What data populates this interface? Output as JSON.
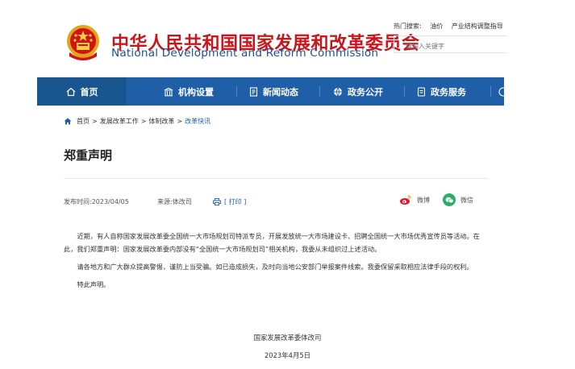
{
  "header": {
    "title_cn": "中华人民共和国国家发展和改革委员会",
    "title_en": "National Development and Reform Commission",
    "hot_label": "热门搜索:",
    "hot_items": [
      "油价",
      "产业结构调整指导"
    ],
    "search_placeholder": "请输入关键字"
  },
  "nav": {
    "items": [
      {
        "label": "首页",
        "icon": "home-icon"
      },
      {
        "label": "机构设置",
        "icon": "building-icon"
      },
      {
        "label": "新闻动态",
        "icon": "news-icon"
      },
      {
        "label": "政务公开",
        "icon": "globe-icon"
      },
      {
        "label": "政务服务",
        "icon": "service-icon"
      }
    ]
  },
  "breadcrumb": {
    "items": [
      "首页",
      "发展改革工作",
      "体制改革",
      "改革快讯"
    ],
    "separator": ">"
  },
  "article": {
    "title": "郑重声明",
    "publish_time": "发布时间:2023/04/05",
    "source": "来源:体改司",
    "print_label": "[ 打印 ]",
    "share_weibo": "微博",
    "share_weixin": "微信",
    "paragraphs": [
      "近期，有人自称国家发展改革委全国统一大市场规划司特派专员，开展发放统一大市场建设卡、招聘全国统一大市场优秀宣传员等活动。在此，我们郑重声明：国家发展改革委内部没有“全国统一大市场规划司”相关机构，我委从未组织过上述活动。",
      "请各地方和广大群众提高警惕，谨防上当受骗。如已造成损失，及时向当地公安部门举报案件线索。我委保留采取相应法律手段的权利。",
      "特此声明。"
    ],
    "signature": "国家发展改革委体改司",
    "date": "2023年4月5日"
  },
  "colors": {
    "brand_red": "#c8161d",
    "brand_blue": "#1f5fa8",
    "nav_active": "#19558f",
    "weibo": "#e6162d",
    "weixin": "#2aae67"
  }
}
